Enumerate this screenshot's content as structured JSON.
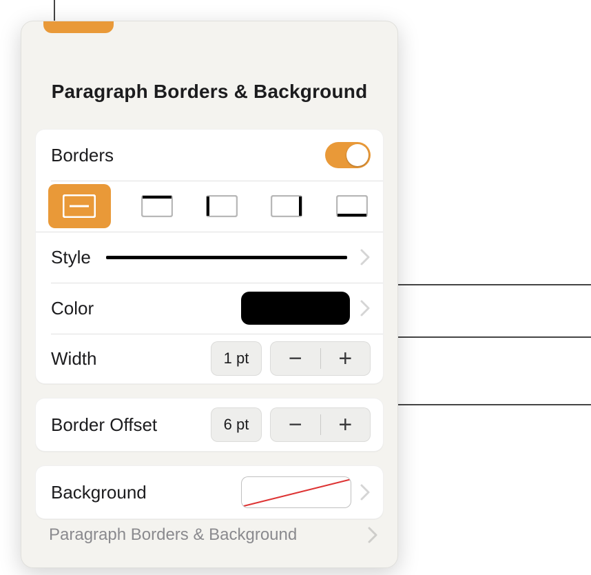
{
  "title": "Paragraph Borders & Background",
  "borders": {
    "section_label": "Borders",
    "toggle_on": true,
    "positions": [
      "outline",
      "top",
      "left",
      "right",
      "bottom"
    ],
    "active_position": "outline"
  },
  "style": {
    "label": "Style",
    "preview": "solid"
  },
  "color": {
    "label": "Color",
    "value_hex": "#000000"
  },
  "width": {
    "label": "Width",
    "value_text": "1 pt"
  },
  "offset": {
    "label": "Border Offset",
    "value_text": "6 pt"
  },
  "background": {
    "label": "Background",
    "value": "none"
  },
  "menu_item": {
    "label": "Paragraph Borders & Background"
  },
  "glyphs": {
    "minus": "−",
    "plus": "+"
  }
}
